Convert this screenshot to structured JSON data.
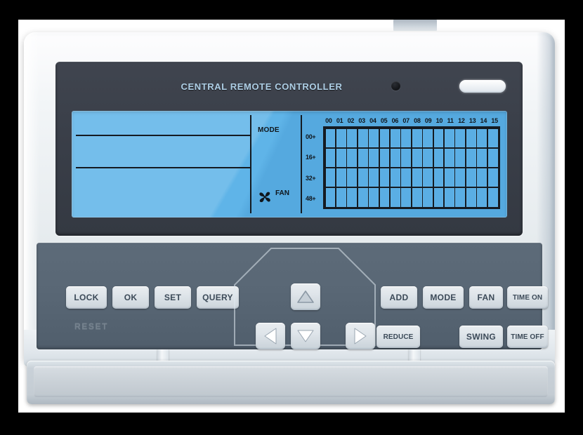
{
  "device": {
    "title": "CENTRAL REMOTE CONTROLLER",
    "sensor_name": "ir-sensor-dot",
    "led_name": "status-led-bar"
  },
  "lcd": {
    "mode_label": "MODE",
    "fan_label": "FAN",
    "column_headers": [
      "00",
      "01",
      "02",
      "03",
      "04",
      "05",
      "06",
      "07",
      "08",
      "09",
      "10",
      "11",
      "12",
      "13",
      "14",
      "15"
    ],
    "row_headers": [
      "00+",
      "16+",
      "32+",
      "48+"
    ],
    "grid_columns": 16,
    "grid_rows": 4,
    "background_color": "#5aaee4",
    "segment_color": "#141b22"
  },
  "buttons": {
    "left_row": [
      {
        "label": "LOCK",
        "name": "lock-button"
      },
      {
        "label": "OK",
        "name": "ok-button"
      },
      {
        "label": "SET",
        "name": "set-button"
      },
      {
        "label": "QUERY",
        "name": "query-button"
      }
    ],
    "reset_label": "RESET",
    "right_top_row": [
      {
        "label": "ADD",
        "name": "add-button"
      },
      {
        "label": "MODE",
        "name": "mode-button"
      },
      {
        "label": "FAN",
        "name": "fan-button"
      },
      {
        "label": "TIME ON",
        "name": "time-on-button"
      }
    ],
    "right_bottom_row": [
      {
        "label": "REDUCE",
        "name": "reduce-button"
      },
      {
        "label": "SWING",
        "name": "swing-button"
      },
      {
        "label": "TIME OFF",
        "name": "time-off-button"
      }
    ],
    "dpad": [
      {
        "name": "arrow-up-button",
        "direction": "up"
      },
      {
        "name": "arrow-left-button",
        "direction": "left"
      },
      {
        "name": "arrow-down-button",
        "direction": "down"
      },
      {
        "name": "arrow-right-button",
        "direction": "right"
      }
    ]
  },
  "colors": {
    "body": "#eef2f5",
    "housing": "#3a3f49",
    "panel": "#596775",
    "lcd_blue": "#5aaee4",
    "title_text": "#aecfe6",
    "button_face": "#dfe5ea",
    "button_text": "#3c4a58"
  }
}
